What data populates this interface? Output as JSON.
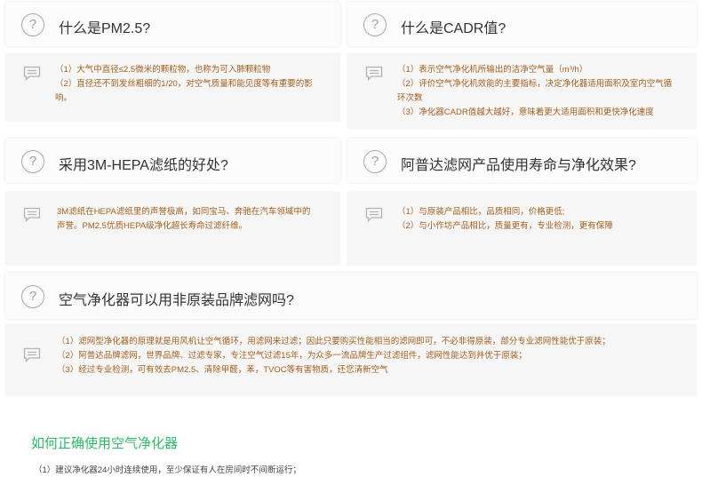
{
  "faq": [
    {
      "question": "什么是PM2.5?",
      "answers": [
        "（1）大气中直径≤2.5微米的颗粒物，也称为可入肺颗粒物",
        "（2）直径还不到发丝粗细的1/20，对空气质量和能见度等有重要的影响。"
      ]
    },
    {
      "question": "什么是CADR值?",
      "answers": [
        "（1）表示空气净化机所输出的洁净空气量（m³/h）",
        "（2）评价空气净化机效能的主要指标，决定净化器适用面积及室内空气循环次数",
        "（3）净化器CADR值越大越好，意味着更大适用面积和更快净化速度"
      ]
    },
    {
      "question": "采用3M-HEPA滤纸的好处?",
      "answers": [
        "3M滤纸在HEPA滤纸里的声誉极高，如同宝马、奔驰在汽车领域中的声誉。PM2.5优质HEPA级净化超长寿命过滤纤维。"
      ]
    },
    {
      "question": "阿普达滤网产品使用寿命与净化效果?",
      "answers": [
        "（1）与原装产品相比，品质相同，价格更低;",
        "（2）与小作坊产品相比，质量更有，专业检测，更有保障"
      ]
    },
    {
      "question": "空气净化器可以用非原装品牌滤网吗?",
      "answers": [
        "（1）滤网型净化器的原理就是用风机让空气循环，用滤网来过滤；因此只要购买性能相当的滤网即可，不必非得原装，部分专业滤网性能优于原装；",
        "（2）阿普达品牌滤网，世界品牌、过滤专家，专注空气过滤15年，为众多一流品牌生产过滤组件，滤网性能达到并优于原装；",
        "（3）经过专业检测，可有效去PM2.5、清除甲醛，苯，TVOC等有害物质，还您清新空气"
      ]
    }
  ],
  "section": {
    "title": "如何正确使用空气净化器",
    "line1": "（1）建议净化器24小时连续使用，至少保证有人在房间时不间断运行；"
  },
  "icons": {
    "question": "question-circle-icon",
    "answer": "comment-icon"
  },
  "colors": {
    "answer_text": "#a35f1f",
    "section_title": "#2fb86a"
  }
}
